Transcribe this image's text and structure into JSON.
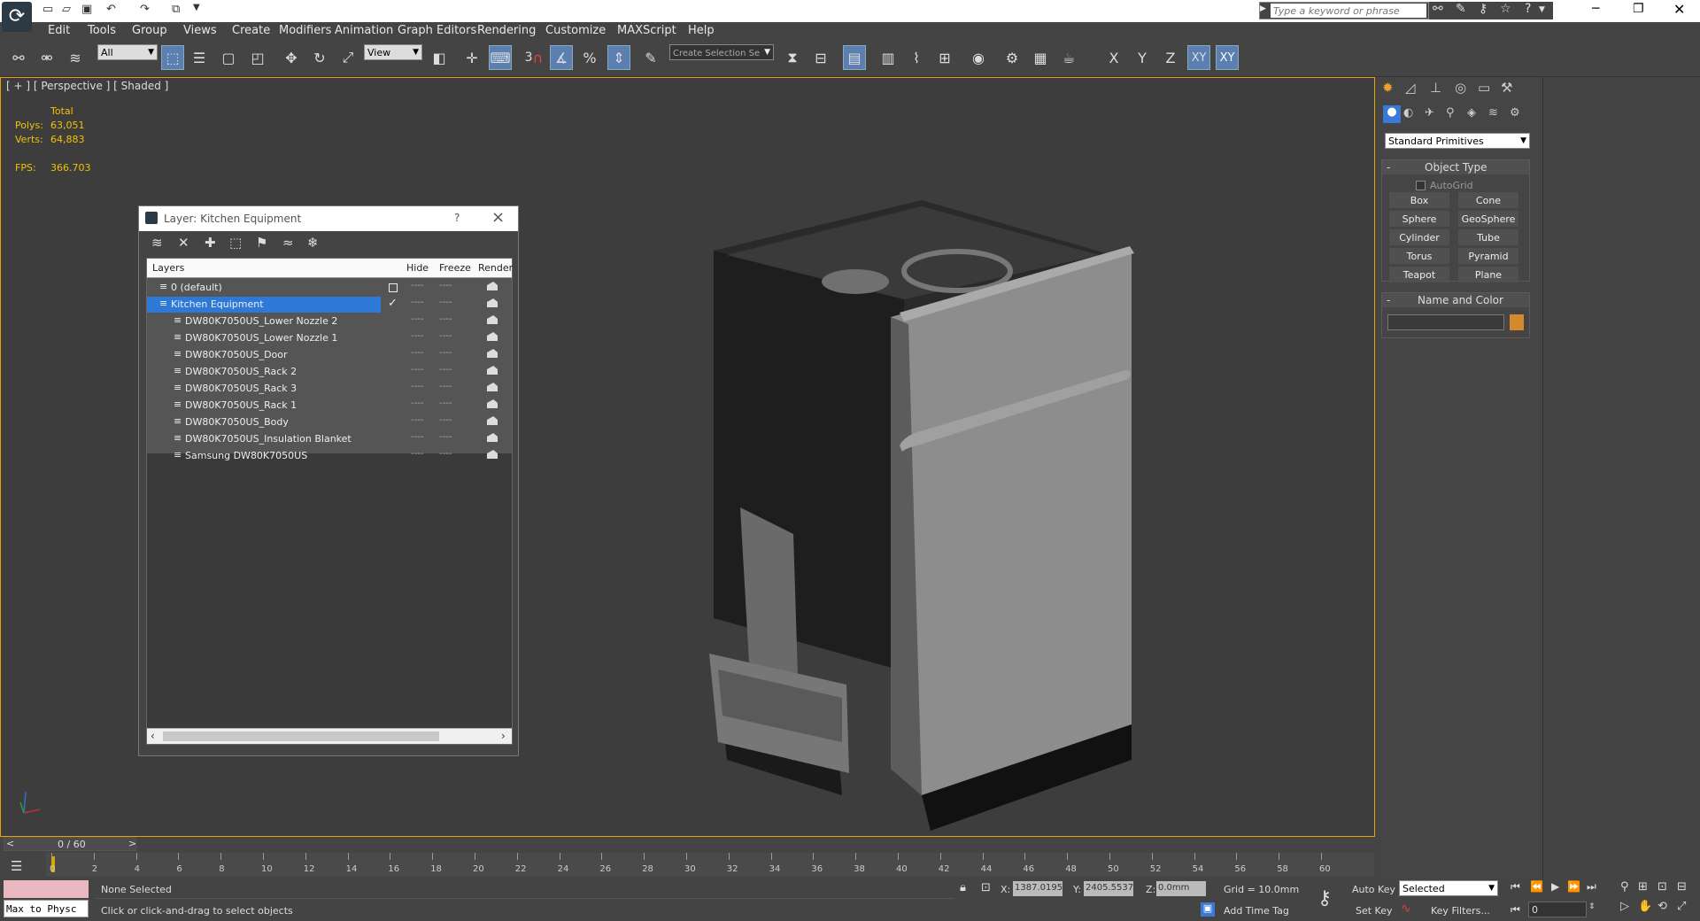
{
  "search": {
    "placeholder": "Type a keyword or phrase"
  },
  "menu": [
    "Edit",
    "Tools",
    "Group",
    "Views",
    "Create",
    "Modifiers",
    "Animation",
    "Graph Editors",
    "Rendering",
    "Customize",
    "MAXScript",
    "Help"
  ],
  "toolbar": {
    "filter_value": "All",
    "refcoord_value": "View",
    "snap_value": "3",
    "selection_set_value": "Create Selection Se",
    "axis_buttons": [
      "X",
      "Y",
      "Z",
      "XY",
      "XY"
    ]
  },
  "viewport": {
    "label": "[ + ] [ Perspective ] [ Shaded ]",
    "stats_header": "Total",
    "polys_label": "Polys:",
    "polys_value": "63,051",
    "verts_label": "Verts:",
    "verts_value": "64,883",
    "fps_label": "FPS:",
    "fps_value": "366.703"
  },
  "dialog": {
    "title": "Layer: Kitchen Equipment",
    "help": "?",
    "close": "×",
    "columns": [
      "Layers",
      "Hide",
      "Freeze",
      "Render"
    ],
    "rows": [
      {
        "name": "0 (default)",
        "level": 0,
        "selected": false
      },
      {
        "name": "Kitchen Equipment",
        "level": 0,
        "selected": true
      },
      {
        "name": "DW80K7050US_Lower Nozzle 2",
        "level": 1,
        "selected": false
      },
      {
        "name": "DW80K7050US_Lower Nozzle 1",
        "level": 1,
        "selected": false
      },
      {
        "name": "DW80K7050US_Door",
        "level": 1,
        "selected": false
      },
      {
        "name": "DW80K7050US_Rack 2",
        "level": 1,
        "selected": false
      },
      {
        "name": "DW80K7050US_Rack 3",
        "level": 1,
        "selected": false
      },
      {
        "name": "DW80K7050US_Rack 1",
        "level": 1,
        "selected": false
      },
      {
        "name": "DW80K7050US_Body",
        "level": 1,
        "selected": false
      },
      {
        "name": "DW80K7050US_Insulation Blanket",
        "level": 1,
        "selected": false
      },
      {
        "name": "Samsung DW80K7050US",
        "level": 1,
        "selected": false
      }
    ],
    "dash": "----"
  },
  "cmd": {
    "category": "Standard Primitives",
    "object_type_label": "Object Type",
    "autogrid_label": "AutoGrid",
    "buttons": [
      "Box",
      "Cone",
      "Sphere",
      "GeoSphere",
      "Cylinder",
      "Tube",
      "Torus",
      "Pyramid",
      "Teapot",
      "Plane"
    ],
    "name_color_label": "Name and Color",
    "object_color": "#d4892e",
    "collapse": "-"
  },
  "timeline": {
    "frame_label": "0 / 60",
    "ticks": [
      "0",
      "2",
      "4",
      "6",
      "8",
      "10",
      "12",
      "14",
      "16",
      "18",
      "20",
      "22",
      "24",
      "26",
      "28",
      "30",
      "32",
      "34",
      "36",
      "38",
      "40",
      "42",
      "44",
      "46",
      "48",
      "50",
      "52",
      "54",
      "56",
      "58",
      "60"
    ]
  },
  "status": {
    "script_listener": "Max to Physc",
    "selection": "None Selected",
    "prompt": "Click or click-and-drag to select objects",
    "x_label": "X:",
    "x_value": "1387.0195",
    "y_label": "Y:",
    "y_value": "2405.5537",
    "z_label": "Z:",
    "z_value": "0.0mm",
    "grid": "Grid = 10.0mm",
    "add_time_tag": "Add Time Tag",
    "auto_key": "Auto Key",
    "set_key": "Set Key",
    "selected_value": "Selected",
    "key_filters": "Key Filters...",
    "frame_value": "0"
  },
  "colors": {
    "accent": "#3a7ad6",
    "viewport_border": "#e8a300",
    "stats": "#f2c200"
  }
}
